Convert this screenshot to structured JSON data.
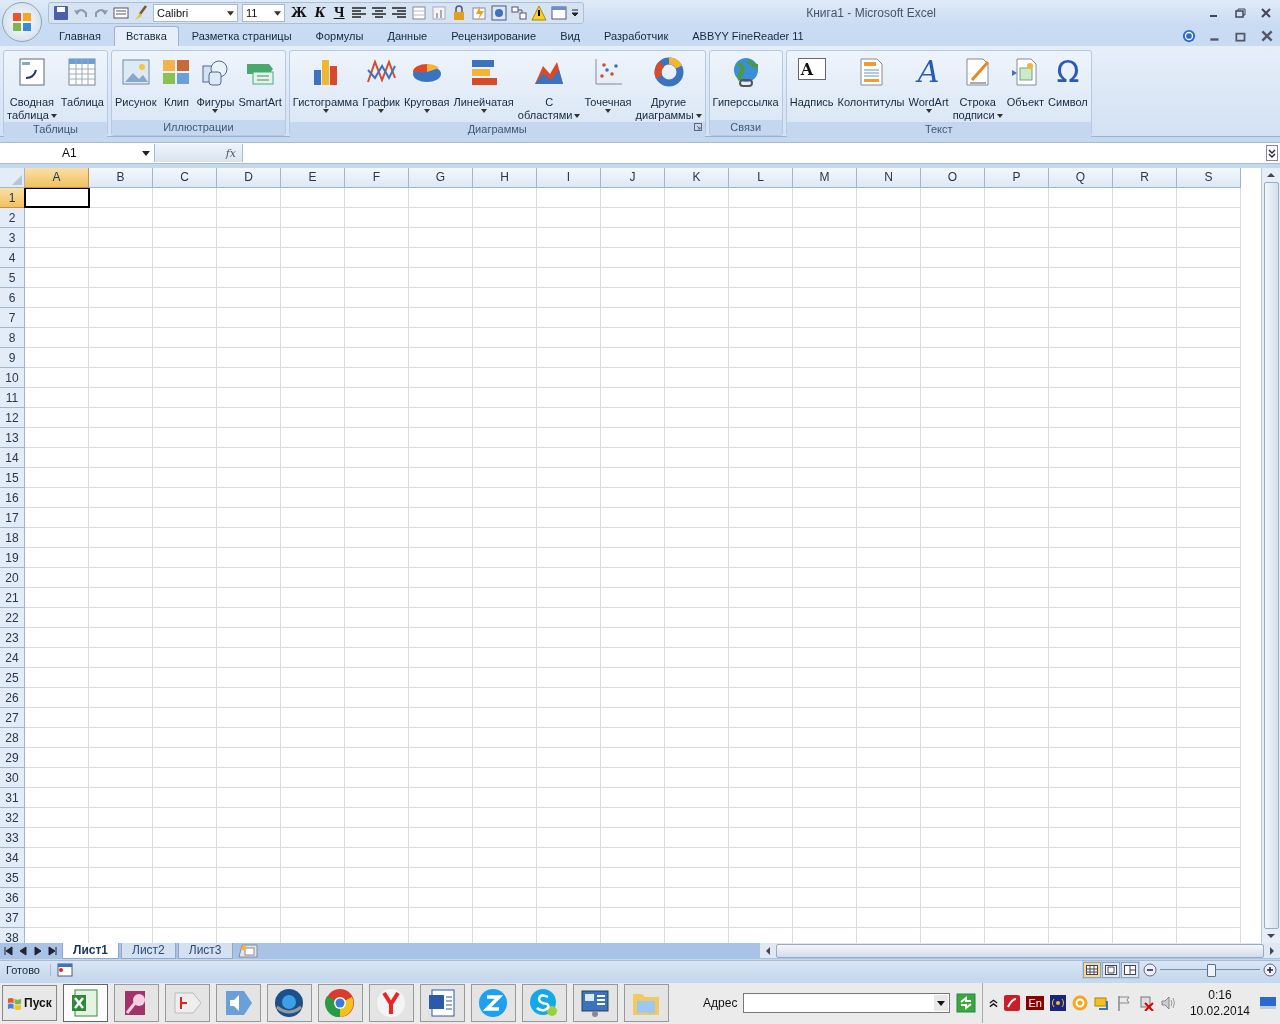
{
  "title_bar": {
    "font": "Calibri",
    "font_size": "11",
    "format_buttons": [
      "Ж",
      "К",
      "Ч"
    ],
    "title": "Книга1 - Microsoft Excel"
  },
  "tabs": [
    {
      "label": "Главная",
      "selected": false
    },
    {
      "label": "Вставка",
      "selected": true
    },
    {
      "label": "Разметка страницы",
      "selected": false
    },
    {
      "label": "Формулы",
      "selected": false
    },
    {
      "label": "Данные",
      "selected": false
    },
    {
      "label": "Рецензирование",
      "selected": false
    },
    {
      "label": "Вид",
      "selected": false
    },
    {
      "label": "Разработчик",
      "selected": false
    },
    {
      "label": "ABBYY FineReader 11",
      "selected": false
    }
  ],
  "ribbon_groups": [
    {
      "label": "Таблицы",
      "launcher": false,
      "buttons": [
        {
          "lines": [
            "Сводная",
            "таблица"
          ],
          "dropdown": true
        },
        {
          "lines": [
            "Таблица"
          ],
          "dropdown": false
        }
      ]
    },
    {
      "label": "Иллюстрации",
      "launcher": false,
      "buttons": [
        {
          "lines": [
            "Рисунок"
          ],
          "dropdown": false
        },
        {
          "lines": [
            "Клип"
          ],
          "dropdown": false
        },
        {
          "lines": [
            "Фигуры"
          ],
          "dropdown": true
        },
        {
          "lines": [
            "SmartArt"
          ],
          "dropdown": false
        }
      ]
    },
    {
      "label": "Диаграммы",
      "launcher": true,
      "buttons": [
        {
          "lines": [
            "Гистограмма"
          ],
          "dropdown": true
        },
        {
          "lines": [
            "График"
          ],
          "dropdown": true
        },
        {
          "lines": [
            "Круговая"
          ],
          "dropdown": true
        },
        {
          "lines": [
            "Линейчатая"
          ],
          "dropdown": true
        },
        {
          "lines": [
            "С",
            "областями"
          ],
          "dropdown": true
        },
        {
          "lines": [
            "Точечная"
          ],
          "dropdown": true
        },
        {
          "lines": [
            "Другие",
            "диаграммы"
          ],
          "dropdown": true
        }
      ]
    },
    {
      "label": "Связи",
      "launcher": false,
      "buttons": [
        {
          "lines": [
            "Гиперссылка"
          ],
          "dropdown": false
        }
      ]
    },
    {
      "label": "Текст",
      "launcher": false,
      "buttons": [
        {
          "lines": [
            "Надпись"
          ],
          "dropdown": false,
          "glyph": "A"
        },
        {
          "lines": [
            "Колонтитулы"
          ],
          "dropdown": false
        },
        {
          "lines": [
            "WordArt"
          ],
          "dropdown": true,
          "glyph": "A"
        },
        {
          "lines": [
            "Строка",
            "подписи"
          ],
          "dropdown": true
        },
        {
          "lines": [
            "Объект"
          ],
          "dropdown": false
        },
        {
          "lines": [
            "Символ"
          ],
          "dropdown": false,
          "glyph": "Ω"
        }
      ]
    }
  ],
  "formula_bar": {
    "name_box": "A1",
    "fx": "fx"
  },
  "columns": [
    {
      "label": "A",
      "selected": true
    },
    {
      "label": "B",
      "selected": false
    },
    {
      "label": "C",
      "selected": false
    },
    {
      "label": "D",
      "selected": false
    },
    {
      "label": "E",
      "selected": false
    },
    {
      "label": "F",
      "selected": false
    },
    {
      "label": "G",
      "selected": false
    },
    {
      "label": "H",
      "selected": false
    },
    {
      "label": "I",
      "selected": false
    },
    {
      "label": "J",
      "selected": false
    },
    {
      "label": "K",
      "selected": false
    },
    {
      "label": "L",
      "selected": false
    },
    {
      "label": "M",
      "selected": false
    },
    {
      "label": "N",
      "selected": false
    },
    {
      "label": "O",
      "selected": false
    },
    {
      "label": "P",
      "selected": false
    },
    {
      "label": "Q",
      "selected": false
    },
    {
      "label": "R",
      "selected": false
    },
    {
      "label": "S",
      "selected": false
    }
  ],
  "rows": [
    {
      "label": "1",
      "selected": true
    },
    {
      "label": "2",
      "selected": false
    },
    {
      "label": "3",
      "selected": false
    },
    {
      "label": "4",
      "selected": false
    },
    {
      "label": "5",
      "selected": false
    },
    {
      "label": "6",
      "selected": false
    },
    {
      "label": "7",
      "selected": false
    },
    {
      "label": "8",
      "selected": false
    },
    {
      "label": "9",
      "selected": false
    },
    {
      "label": "10",
      "selected": false
    },
    {
      "label": "11",
      "selected": false
    },
    {
      "label": "12",
      "selected": false
    },
    {
      "label": "13",
      "selected": false
    },
    {
      "label": "14",
      "selected": false
    },
    {
      "label": "15",
      "selected": false
    },
    {
      "label": "16",
      "selected": false
    },
    {
      "label": "17",
      "selected": false
    },
    {
      "label": "18",
      "selected": false
    },
    {
      "label": "19",
      "selected": false
    },
    {
      "label": "20",
      "selected": false
    },
    {
      "label": "21",
      "selected": false
    },
    {
      "label": "22",
      "selected": false
    },
    {
      "label": "23",
      "selected": false
    },
    {
      "label": "24",
      "selected": false
    },
    {
      "label": "25",
      "selected": false
    },
    {
      "label": "26",
      "selected": false
    },
    {
      "label": "27",
      "selected": false
    },
    {
      "label": "28",
      "selected": false
    },
    {
      "label": "29",
      "selected": false
    },
    {
      "label": "30",
      "selected": false
    },
    {
      "label": "31",
      "selected": false
    },
    {
      "label": "32",
      "selected": false
    },
    {
      "label": "33",
      "selected": false
    },
    {
      "label": "34",
      "selected": false
    },
    {
      "label": "35",
      "selected": false
    },
    {
      "label": "36",
      "selected": false
    },
    {
      "label": "37",
      "selected": false
    },
    {
      "label": "38",
      "selected": false
    }
  ],
  "sheet_tabs": [
    {
      "label": "Лист1",
      "selected": true
    },
    {
      "label": "Лист2",
      "selected": false
    },
    {
      "label": "Лист3",
      "selected": false
    }
  ],
  "status_bar": {
    "status": "Готово",
    "views": [
      {
        "selected": true
      },
      {
        "selected": false
      },
      {
        "selected": false
      }
    ],
    "zoom": {
      "level": 0.5
    }
  },
  "taskbar": {
    "start": "Пуск",
    "apps": [
      {
        "selected": true
      },
      {
        "selected": false
      },
      {
        "selected": false
      },
      {
        "selected": false
      },
      {
        "selected": false
      },
      {
        "selected": false
      },
      {
        "selected": false
      },
      {
        "selected": false
      },
      {
        "selected": false
      },
      {
        "selected": false
      },
      {
        "selected": false
      },
      {
        "selected": false
      }
    ],
    "address_label": "Адрес",
    "language": "En",
    "time": "0:16",
    "date": "10.02.2014"
  }
}
